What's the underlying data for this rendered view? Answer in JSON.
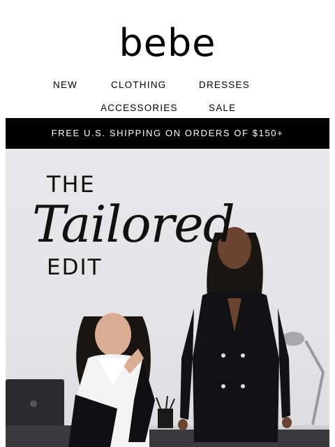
{
  "brand": {
    "logo_text": "bebe"
  },
  "nav": {
    "row1": [
      {
        "label": "NEW"
      },
      {
        "label": "CLOTHING"
      },
      {
        "label": "DRESSES"
      }
    ],
    "row2": [
      {
        "label": "ACCESSORIES"
      },
      {
        "label": "SALE"
      }
    ]
  },
  "promo_banner": {
    "text": "FREE U.S. SHIPPING ON ORDERS OF $150+"
  },
  "hero": {
    "headline_line1": "THE",
    "headline_line2": "Tailored",
    "headline_line3": "EDIT"
  },
  "colors": {
    "banner_bg": "#000000",
    "hero_bg": "#e6e6e8",
    "text": "#111111"
  }
}
